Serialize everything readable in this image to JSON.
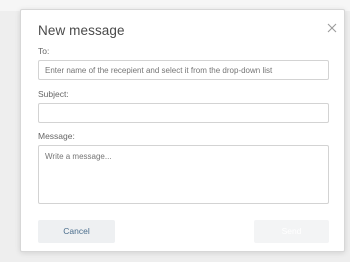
{
  "dialog": {
    "title": "New message",
    "to": {
      "label": "To:",
      "placeholder": "Enter name of the recepient and select it from the drop-down list"
    },
    "subject": {
      "label": "Subject:",
      "placeholder": ""
    },
    "message": {
      "label": "Message:",
      "placeholder": "Write a message..."
    },
    "buttons": {
      "cancel": "Cancel",
      "send": "Send"
    }
  },
  "icons": {
    "close": "close-icon"
  },
  "colors": {
    "cancel_text": "#4a6d8c",
    "send_background": "#f3f4f5"
  }
}
